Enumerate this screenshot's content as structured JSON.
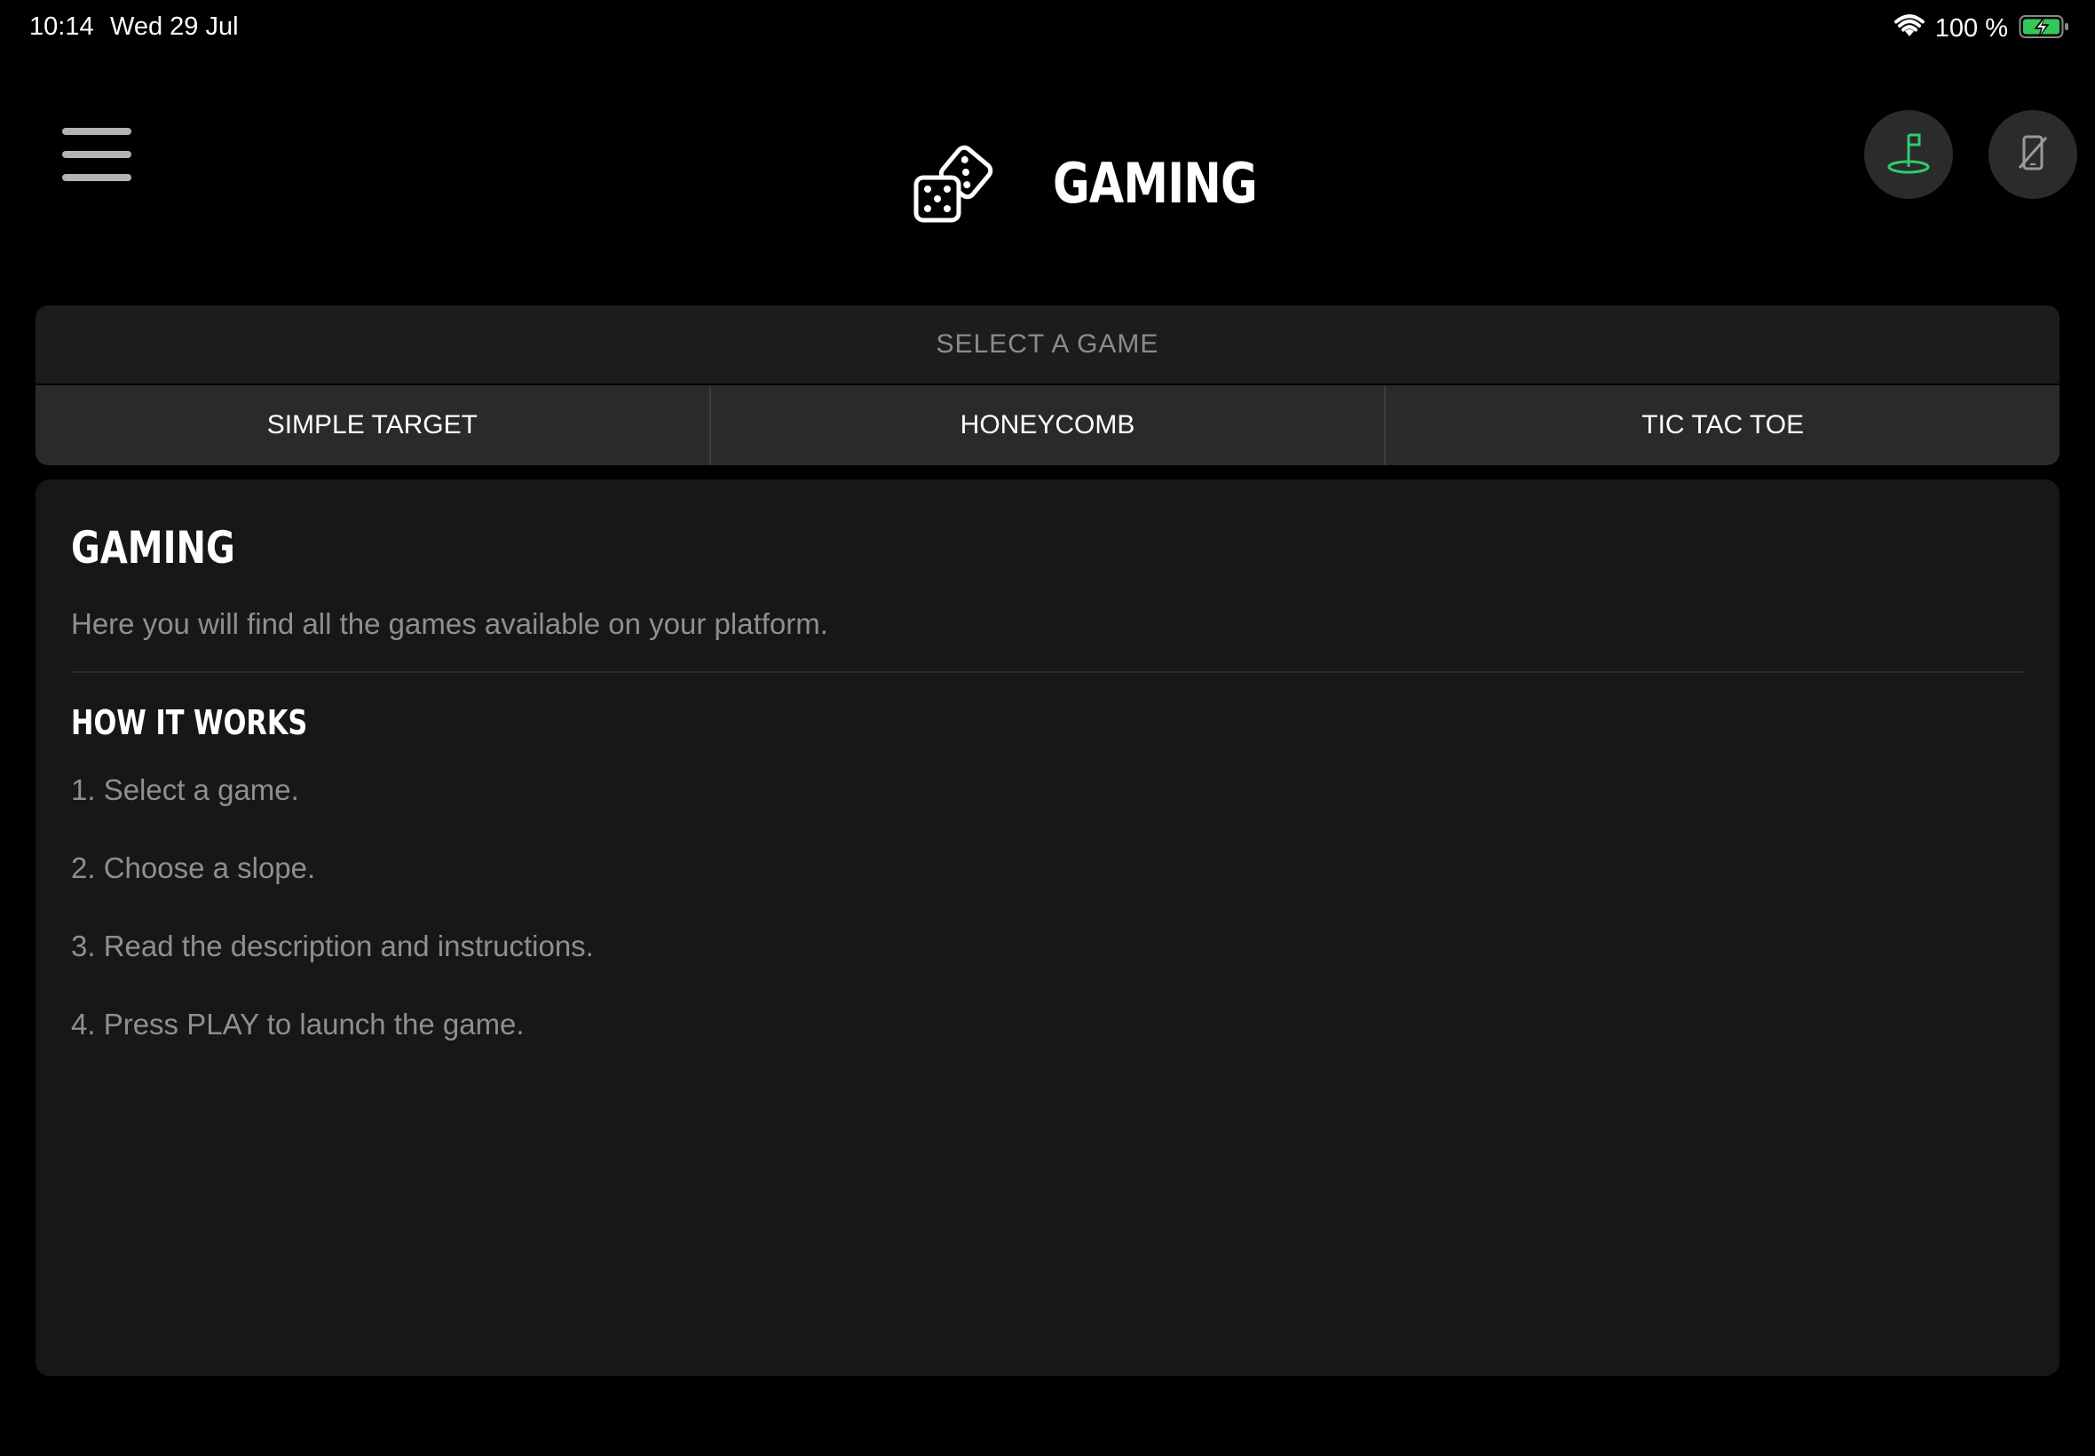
{
  "status_bar": {
    "time": "10:14",
    "date": "Wed 29 Jul",
    "battery": "100 %"
  },
  "header": {
    "title": "GAMING",
    "logo_icon": "dice-icon",
    "menu_icon": "hamburger-menu-icon",
    "right_buttons": [
      {
        "icon": "golf-flag-icon",
        "color": "#2ecc71"
      },
      {
        "icon": "phone-disabled-icon",
        "color": "#9a9a9a"
      }
    ]
  },
  "selector": {
    "label": "SELECT A GAME",
    "games": [
      "SIMPLE TARGET",
      "HONEYCOMB",
      "TIC TAC TOE"
    ]
  },
  "content": {
    "title": "GAMING",
    "description": "Here you will find all the games available on your platform.",
    "how_title": "HOW IT WORKS",
    "steps": [
      "1. Select a game.",
      "2. Choose a slope.",
      "3. Read the description and instructions.",
      "4. Press PLAY to launch the game."
    ]
  },
  "colors": {
    "background": "#000000",
    "card": "#171717",
    "tab_bar": "#2a2a2a",
    "accent_green": "#2ecc71",
    "muted_text": "#8f8f8f"
  }
}
